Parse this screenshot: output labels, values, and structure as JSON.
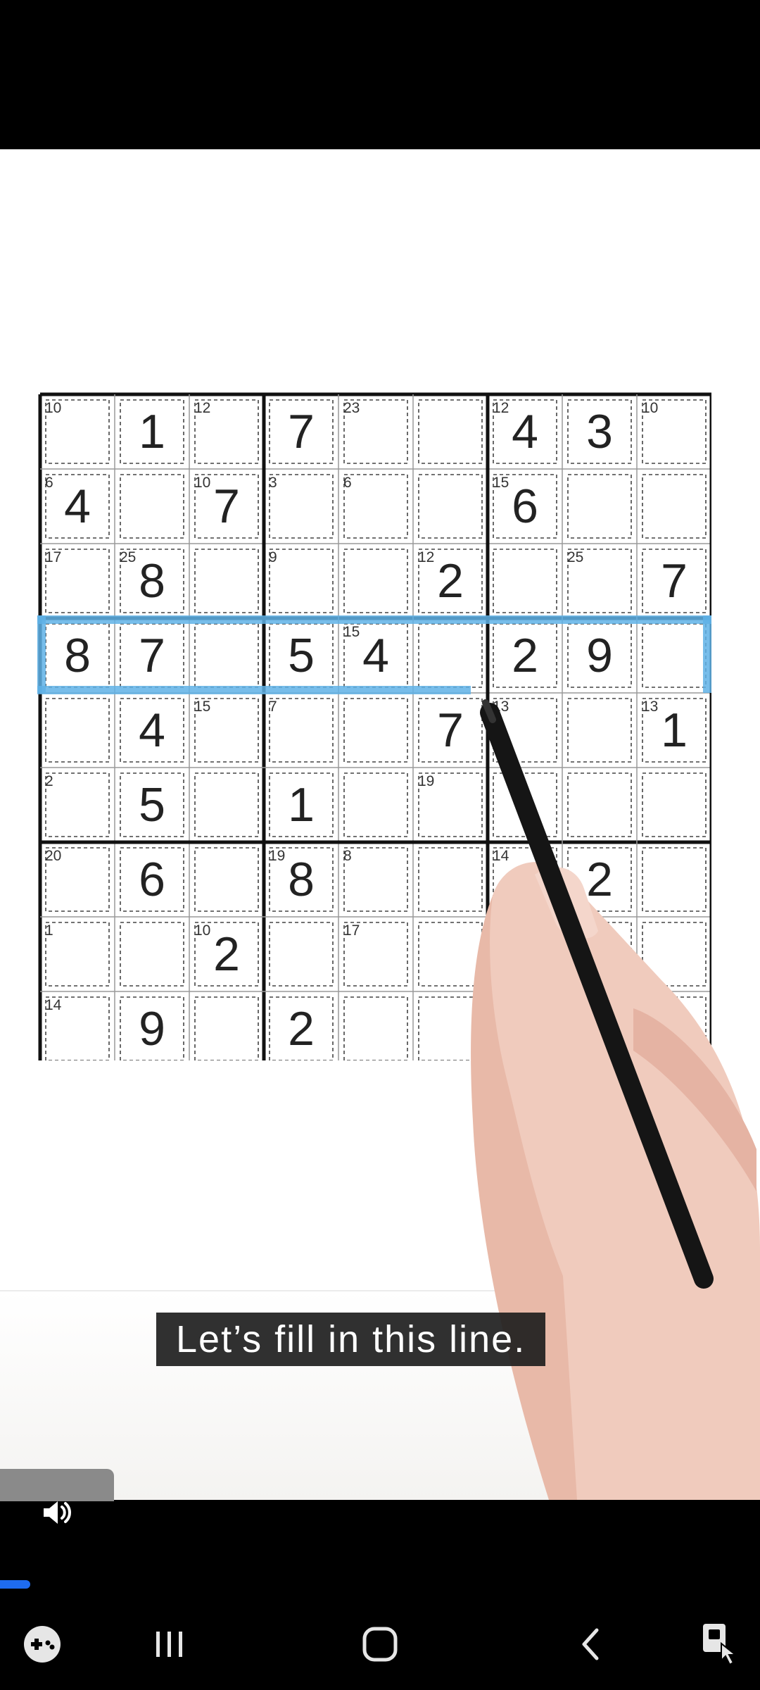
{
  "caption": {
    "text": "Let’s fill in this line."
  },
  "puzzle": {
    "digits": [
      {
        "r": 0,
        "c": 1,
        "v": "1"
      },
      {
        "r": 0,
        "c": 3,
        "v": "7"
      },
      {
        "r": 0,
        "c": 6,
        "v": "4"
      },
      {
        "r": 0,
        "c": 7,
        "v": "3"
      },
      {
        "r": 1,
        "c": 0,
        "v": "4"
      },
      {
        "r": 1,
        "c": 2,
        "v": "7"
      },
      {
        "r": 1,
        "c": 6,
        "v": "6"
      },
      {
        "r": 2,
        "c": 1,
        "v": "8"
      },
      {
        "r": 2,
        "c": 5,
        "v": "2"
      },
      {
        "r": 2,
        "c": 8,
        "v": "7"
      },
      {
        "r": 3,
        "c": 0,
        "v": "8"
      },
      {
        "r": 3,
        "c": 1,
        "v": "7"
      },
      {
        "r": 3,
        "c": 3,
        "v": "5"
      },
      {
        "r": 3,
        "c": 4,
        "v": "4"
      },
      {
        "r": 3,
        "c": 6,
        "v": "2"
      },
      {
        "r": 3,
        "c": 7,
        "v": "9"
      },
      {
        "r": 4,
        "c": 1,
        "v": "4"
      },
      {
        "r": 4,
        "c": 5,
        "v": "7"
      },
      {
        "r": 4,
        "c": 8,
        "v": "1"
      },
      {
        "r": 5,
        "c": 1,
        "v": "5"
      },
      {
        "r": 5,
        "c": 3,
        "v": "1"
      },
      {
        "r": 6,
        "c": 1,
        "v": "6"
      },
      {
        "r": 6,
        "c": 3,
        "v": "8"
      },
      {
        "r": 6,
        "c": 7,
        "v": "2"
      },
      {
        "r": 7,
        "c": 2,
        "v": "2"
      },
      {
        "r": 8,
        "c": 1,
        "v": "9"
      },
      {
        "r": 8,
        "c": 3,
        "v": "2"
      },
      {
        "r": 8,
        "c": 7,
        "v": "4"
      }
    ],
    "cage_sums": [
      {
        "r": 0,
        "c": 0,
        "v": "10"
      },
      {
        "r": 0,
        "c": 2,
        "v": "12"
      },
      {
        "r": 0,
        "c": 4,
        "v": "23"
      },
      {
        "r": 0,
        "c": 6,
        "v": "12"
      },
      {
        "r": 0,
        "c": 8,
        "v": "10"
      },
      {
        "r": 1,
        "c": 0,
        "v": "6"
      },
      {
        "r": 1,
        "c": 2,
        "v": "10"
      },
      {
        "r": 1,
        "c": 3,
        "v": "3"
      },
      {
        "r": 1,
        "c": 4,
        "v": "6"
      },
      {
        "r": 1,
        "c": 6,
        "v": "15"
      },
      {
        "r": 2,
        "c": 0,
        "v": "17"
      },
      {
        "r": 2,
        "c": 1,
        "v": "25"
      },
      {
        "r": 2,
        "c": 3,
        "v": "9"
      },
      {
        "r": 2,
        "c": 5,
        "v": "12"
      },
      {
        "r": 2,
        "c": 7,
        "v": "25"
      },
      {
        "r": 3,
        "c": 4,
        "v": "15"
      },
      {
        "r": 4,
        "c": 2,
        "v": "15"
      },
      {
        "r": 4,
        "c": 3,
        "v": "7"
      },
      {
        "r": 4,
        "c": 6,
        "v": "13"
      },
      {
        "r": 4,
        "c": 8,
        "v": "13"
      },
      {
        "r": 5,
        "c": 0,
        "v": "2"
      },
      {
        "r": 5,
        "c": 5,
        "v": "19"
      },
      {
        "r": 6,
        "c": 0,
        "v": "20"
      },
      {
        "r": 6,
        "c": 3,
        "v": "19"
      },
      {
        "r": 6,
        "c": 4,
        "v": "8"
      },
      {
        "r": 6,
        "c": 6,
        "v": "14"
      },
      {
        "r": 7,
        "c": 0,
        "v": "1"
      },
      {
        "r": 7,
        "c": 2,
        "v": "10"
      },
      {
        "r": 7,
        "c": 4,
        "v": "17"
      },
      {
        "r": 8,
        "c": 0,
        "v": "14"
      }
    ],
    "highlight_color": "#5fb2e6"
  },
  "player": {
    "progress": 0.04,
    "progress_color": "#1e6cf0",
    "volume_icon": "volume-icon"
  },
  "nav": {
    "game_icon": "gamepad-icon",
    "recents_icon": "recents-icon",
    "home_icon": "home-icon",
    "back_icon": "back-icon",
    "assistant_icon": "accessibility-icon"
  }
}
